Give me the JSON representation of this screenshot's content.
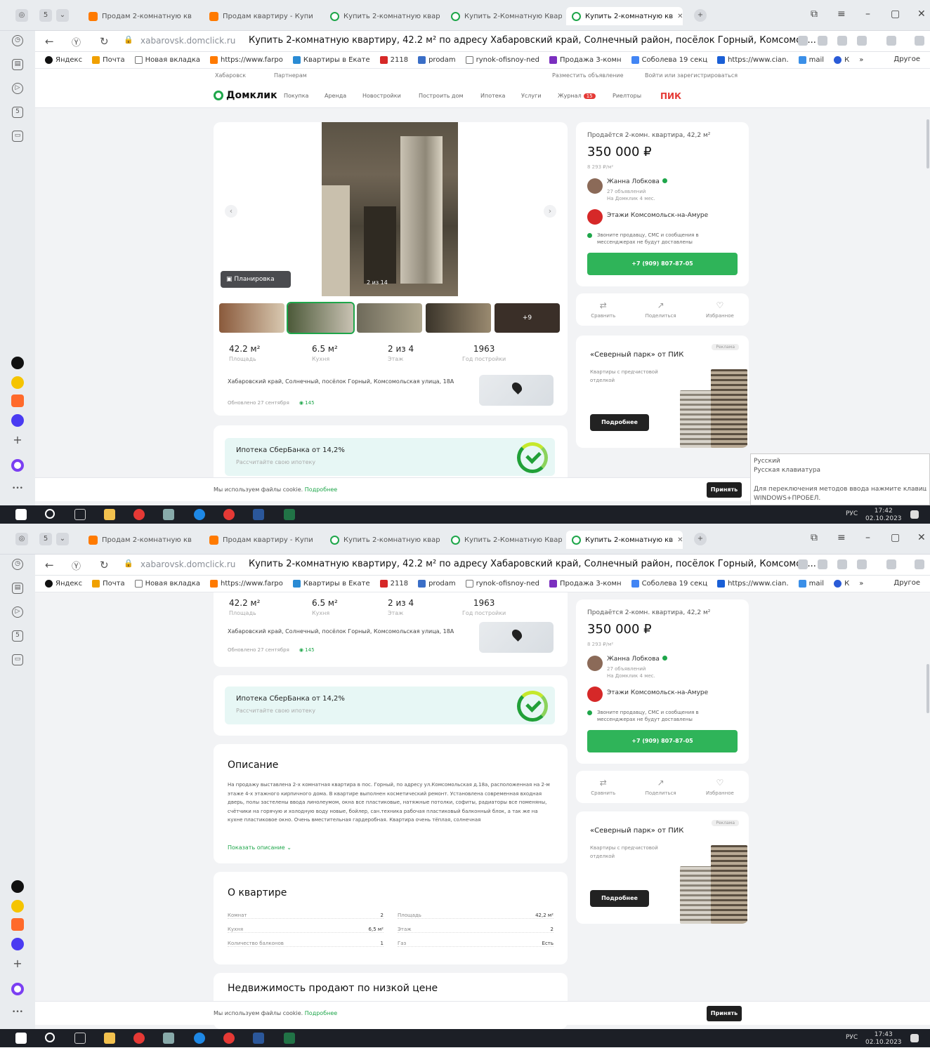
{
  "browser": {
    "tabs": [
      {
        "label": "Продам 2-комнатную кв"
      },
      {
        "label": "Продам квартиру - Купи"
      },
      {
        "label": "Купить 2-комнатную квар"
      },
      {
        "label": "Купить 2-Комнатную Квар"
      },
      {
        "label": "Купить 2-комнатную кв"
      }
    ],
    "domain": "xabarovsk.domclick.ru",
    "page_title": "Купить 2-комнатную квартиру, 42.2 м² по адресу Хабаровский край, Солнечный район, посёлок Горный, Комсомол...",
    "bookmarks": [
      "Яндекс",
      "Почта",
      "Новая вкладка",
      "https://www.farpo",
      "Квартиры в Екате",
      "2118",
      "prodam",
      "rynok-ofisnoy-ned",
      "Продажа 3-комн",
      "Соболева 19 секц",
      "https://www.cian.",
      "mail",
      "К",
      "»"
    ],
    "bookmarks_other": "Другое"
  },
  "site": {
    "utility": [
      "Хабаровск",
      "Партнерам",
      "Разместить объявление",
      "Войти или зарегистрироваться"
    ],
    "logo": "Домклик",
    "nav": [
      "Покупка",
      "Аренда",
      "Новостройки",
      "Построить дом",
      "Ипотека",
      "Услуги",
      "Журнал",
      "Риелторы"
    ],
    "journal_badge": "15",
    "partner": "ПИК"
  },
  "listing": {
    "plan_button": "Планировка",
    "photo_counter": "2 из 14",
    "more_photos": "+9",
    "stats": [
      {
        "value": "42.2 м²",
        "label": "Площадь"
      },
      {
        "value": "6.5 м²",
        "label": "Кухня"
      },
      {
        "value": "2 из 4",
        "label": "Этаж"
      },
      {
        "value": "1963",
        "label": "Год постройки"
      }
    ],
    "address": "Хабаровский край, Солнечный, посёлок Горный, Комсомольская улица, 18А",
    "updated": "Обновлено 27 сентября",
    "views": "145",
    "mortgage_title": "Ипотека СберБанка от 14,2%",
    "mortgage_sub": "Рассчитайте свою ипотеку"
  },
  "offer": {
    "heading": "Продаётся 2-комн. квартира, 42,2 м²",
    "price": "350 000 ₽",
    "price_per_m": "8 293 ₽/м²",
    "seller_name": "Жанна Лобкова",
    "seller_ads": "27 объявлений",
    "seller_since": "На Домклик 4 мес.",
    "agency": "Этажи Комсомольск-на-Амуре",
    "note": "Звоните продавцу, СМС и сообщения в мессенджерах не будут доставлены",
    "phone": "+7 (909) 807-87-05",
    "actions": [
      "Сравнить",
      "Поделиться",
      "Избранное"
    ]
  },
  "ad": {
    "tag": "Реклама",
    "title": "«Северный парк» от ПИК",
    "subtitle": "Квартиры с предчистовой отделкой",
    "button": "Подробнее"
  },
  "description": {
    "heading": "Описание",
    "text": "На продажу выставлена 2-х комнатная квартира в пос. Горный, по адресу ул.Комсомольская д.18а, расположенная на 2-м этаже 4-х этажного кирпичного дома. В квартире выполнен косметический ремонт. Установлена современная входная дверь, полы застелены ввода линолеумом, окна все пластиковые, натяжные потолки, софиты, радиаторы все поменяны, счётчики на горячую и холодную воду новые, бойлер, сан.техника рабочая пластиковый балконный блок, а так же на кухне пластиковое окно. Очень вместительная гардеробная. Квартира очень тёплая, солнечная",
    "more": "Показать описание"
  },
  "about": {
    "heading": "О квартире",
    "left": [
      {
        "label": "Комнат",
        "value": "2"
      },
      {
        "label": "Кухня",
        "value": "6,5 м²"
      },
      {
        "label": "Количество балконов",
        "value": "1"
      }
    ],
    "right": [
      {
        "label": "Площадь",
        "value": "42,2 м²"
      },
      {
        "label": "Этаж",
        "value": "2"
      },
      {
        "label": "Газ",
        "value": "Есть"
      }
    ]
  },
  "low_price_heading": "Недвижимость продают по низкой цене",
  "cookie": {
    "text": "Мы используем файлы cookie.",
    "more": "Подробнее",
    "accept": "Принять"
  },
  "ime_tip": [
    "Русский",
    "Русская клавиатура",
    "Для переключения методов ввода нажмите клавишу",
    "WINDOWS+ПРОБЕЛ."
  ],
  "taskbar": [
    {
      "time": "17:42",
      "date": "02.10.2023",
      "lang": "РУС"
    },
    {
      "time": "17:43",
      "date": "02.10.2023",
      "lang": "РУС"
    }
  ],
  "colors": {
    "brand_green": "#1ea64a",
    "phone_green": "#2fb459",
    "pik_red": "#e53935",
    "mortgage_bg": "#e7f7f5"
  }
}
